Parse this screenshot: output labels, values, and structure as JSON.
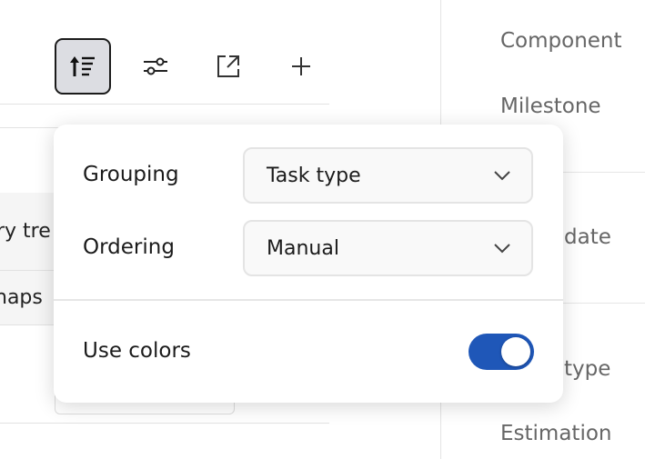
{
  "toolbar": {
    "sort": "sort-icon",
    "settings": "sliders-icon",
    "open": "external-link-icon",
    "add": "plus-icon"
  },
  "rows": [
    "ry tre",
    "naps"
  ],
  "right_panel": {
    "items": [
      "Component",
      "Milestone",
      "date",
      "type",
      "Estimation"
    ]
  },
  "popup": {
    "grouping_label": "Grouping",
    "grouping_value": "Task type",
    "ordering_label": "Ordering",
    "ordering_value": "Manual",
    "colors_label": "Use colors",
    "colors_on": true
  },
  "colors": {
    "accent": "#1f57b8"
  }
}
